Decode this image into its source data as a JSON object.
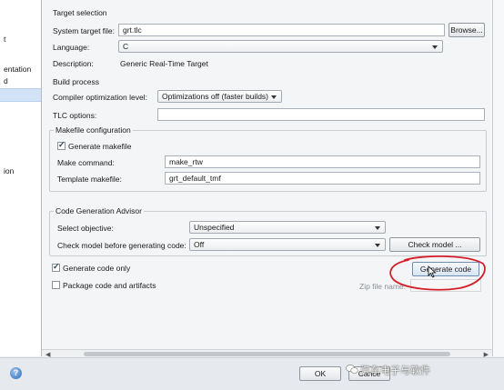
{
  "tree": {
    "fragments": [
      "t",
      "entation",
      "d",
      "ion"
    ]
  },
  "target_selection": {
    "title": "Target selection",
    "system_target_file_label": "System target file:",
    "system_target_file_value": "grt.tlc",
    "browse_label": "Browse...",
    "language_label": "Language:",
    "language_value": "C",
    "description_label": "Description:",
    "description_value": "Generic Real-Time Target"
  },
  "build_process": {
    "title": "Build process",
    "compiler_opt_label": "Compiler optimization level:",
    "compiler_opt_value": "Optimizations off (faster builds)",
    "tlc_options_label": "TLC options:",
    "tlc_options_value": "",
    "makefile_title": "Makefile configuration",
    "generate_makefile_label": "Generate makefile",
    "generate_makefile_checked": true,
    "make_command_label": "Make command:",
    "make_command_value": "make_rtw",
    "template_makefile_label": "Template makefile:",
    "template_makefile_value": "grt_default_tmf"
  },
  "advisor": {
    "title": "Code Generation Advisor",
    "select_objective_label": "Select objective:",
    "select_objective_value": "Unspecified",
    "check_model_label": "Check model before generating code:",
    "check_model_value": "Off",
    "check_model_button": "Check model ..."
  },
  "generate": {
    "generate_code_only_label": "Generate code only",
    "generate_code_only_checked": true,
    "package_label": "Package code and artifacts",
    "package_checked": false,
    "zip_label": "Zip file name:",
    "zip_value": "",
    "generate_code_button": "Generate code"
  },
  "footer": {
    "ok_label": "OK",
    "cancel_label": "Cance",
    "watermark": "汽车电子与软件",
    "help_icon": "help-icon"
  },
  "colors": {
    "annotation": "#d41f2a",
    "selection": "#d2e3f7"
  }
}
